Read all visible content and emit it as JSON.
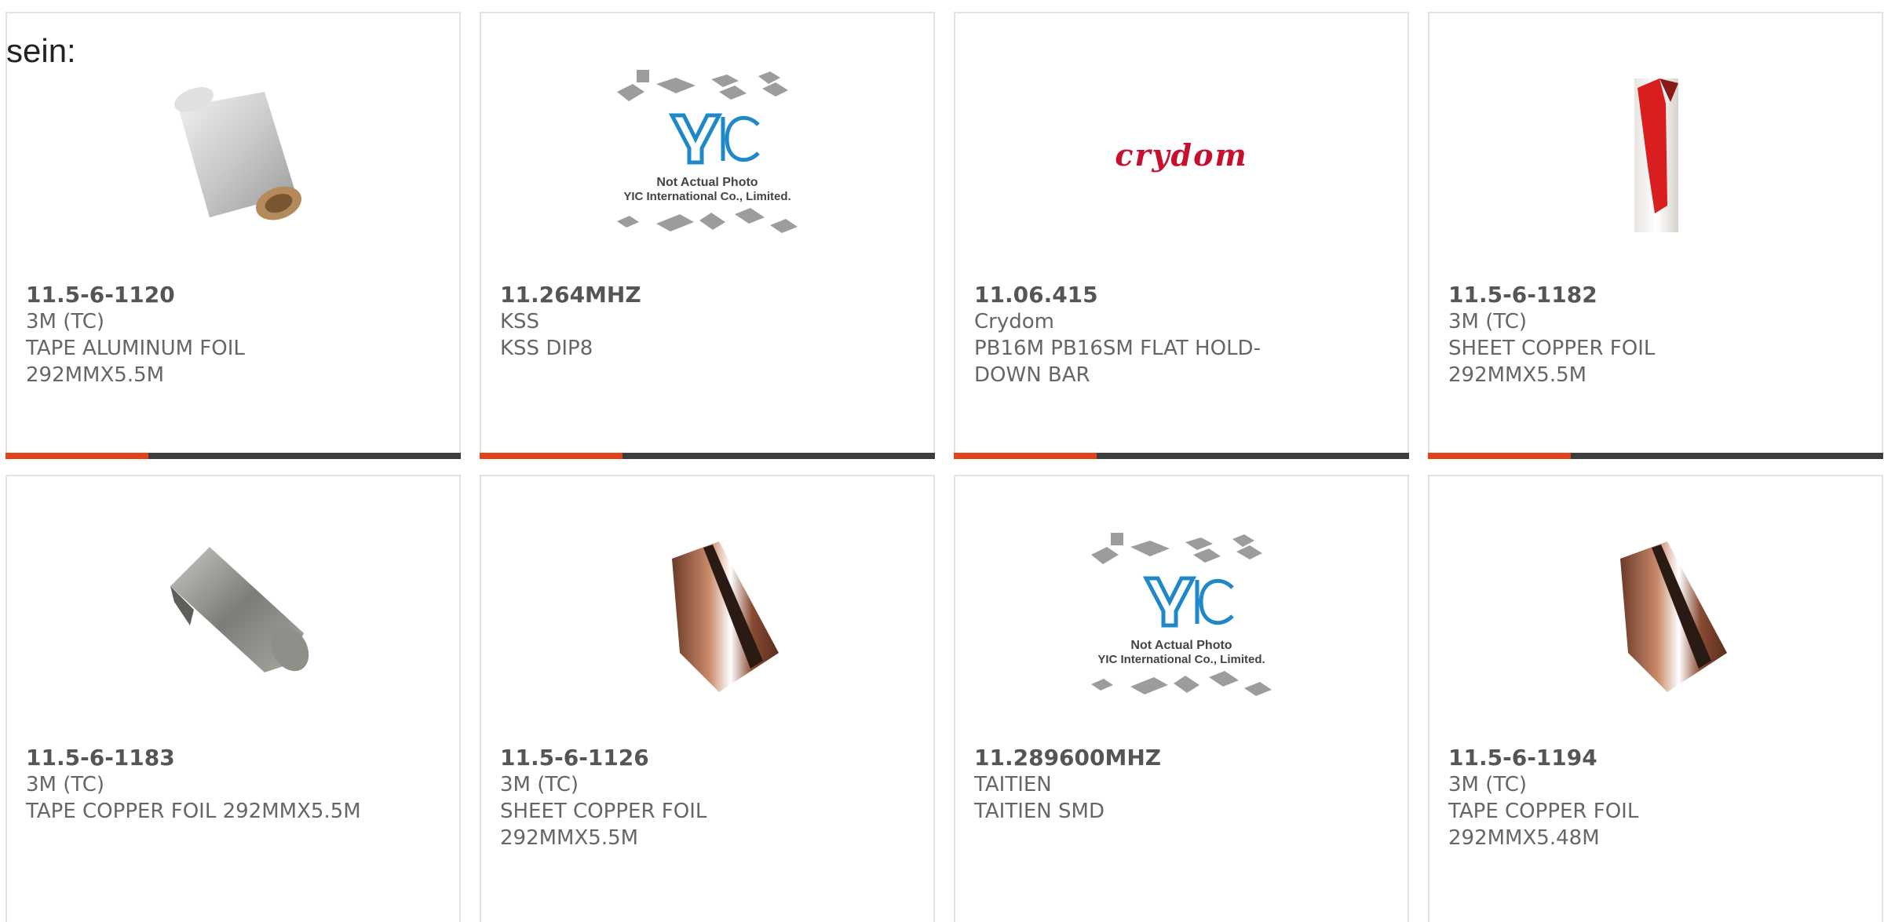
{
  "page": {
    "prefix_text": "sein:"
  },
  "colors": {
    "accent": "#e04418",
    "bar": "#3d3d3d",
    "card_border": "#e2e2e2",
    "crydom_red": "#c8102e",
    "text_muted": "#666666"
  },
  "products": [
    {
      "part": "11.5-6-1120",
      "manufacturer": "3M (TC)",
      "description": "TAPE ALUMINUM FOIL 292MMX5.5M",
      "image": "aluminum-foil-roll-image"
    },
    {
      "part": "11.264MHZ",
      "manufacturer": "KSS",
      "description": "KSS DIP8",
      "image": "yic-placeholder-image"
    },
    {
      "part": "11.06.415",
      "manufacturer": "Crydom",
      "description": "PB16M PB16SM FLAT HOLD-DOWN BAR",
      "image": "crydom-logo"
    },
    {
      "part": "11.5-6-1182",
      "manufacturer": "3M (TC)",
      "description": "SHEET COPPER FOIL 292MMX5.5M",
      "image": "copper-foil-sheet-image"
    },
    {
      "part": "11.5-6-1183",
      "manufacturer": "3M (TC)",
      "description": "TAPE COPPER FOIL 292MMX5.5M",
      "image": "copper-foil-tape-image"
    },
    {
      "part": "11.5-6-1126",
      "manufacturer": "3M (TC)",
      "description": "SHEET COPPER FOIL 292MMX5.5M",
      "image": "copper-foil-roll-image"
    },
    {
      "part": "11.289600MHZ",
      "manufacturer": "TAITIEN",
      "description": "TAITIEN SMD",
      "image": "yic-placeholder-image"
    },
    {
      "part": "11.5-6-1194",
      "manufacturer": "3M (TC)",
      "description": "TAPE COPPER FOIL 292MMX5.48M",
      "image": "copper-foil-roll-image"
    }
  ],
  "placeholder": {
    "brand": "YIC",
    "line1": "Not Actual Photo",
    "line2": "YIC International Co., Limited."
  },
  "crydom_logo_text": "crydom"
}
